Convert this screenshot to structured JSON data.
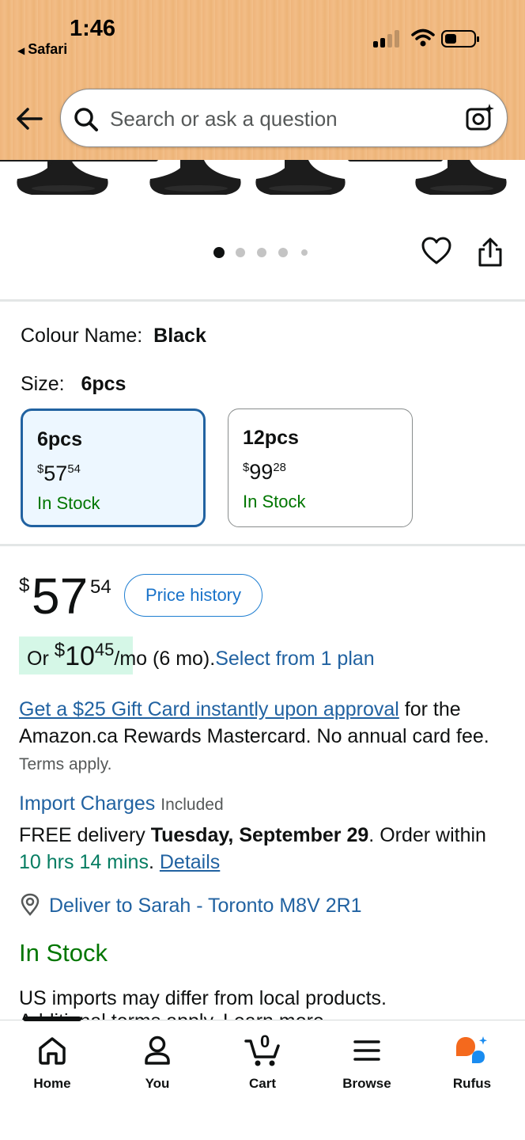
{
  "status_bar": {
    "time": "1:46",
    "back_app": "Safari"
  },
  "search": {
    "placeholder": "Search or ask a question"
  },
  "gallery": {
    "dots_count": 5,
    "active_dot": 0
  },
  "variation": {
    "colour_label": "Colour Name:",
    "colour_value": "Black",
    "size_label": "Size:",
    "size_value": "6pcs",
    "options": [
      {
        "name": "6pcs",
        "currency": "$",
        "whole": "57",
        "fraction": "54",
        "stock": "In Stock",
        "selected": true
      },
      {
        "name": "12pcs",
        "currency": "$",
        "whole": "99",
        "fraction": "28",
        "stock": "In Stock",
        "selected": false
      }
    ]
  },
  "price": {
    "currency": "$",
    "whole": "57",
    "fraction": "54",
    "price_history_label": "Price history"
  },
  "installment": {
    "prefix": "Or",
    "currency": "$",
    "whole": "10",
    "fraction": "45",
    "suffix": "/mo (6 mo).",
    "plan_link": "Select from 1 plan"
  },
  "gift_card": {
    "link": "Get a $25 Gift Card instantly upon approval",
    "text": " for the Amazon.ca Rewards Mastercard. No annual card fee.",
    "terms": "Terms apply."
  },
  "import": {
    "link": "Import Charges",
    "note": "Included"
  },
  "delivery": {
    "free_text": "FREE delivery ",
    "date": "Tuesday, September 29",
    "order_within": ". Order within ",
    "countdown": "10 hrs 14 mins",
    "period": ". ",
    "details_link": "Details"
  },
  "deliver_to": "Deliver to Sarah - Toronto M8V 2R1",
  "stock_status": "In Stock",
  "import_notice": "US imports may differ from local products.",
  "cut_text": "Additional terms apply. Learn more",
  "bottom_nav": {
    "items": [
      {
        "label": "Home",
        "icon": "home-icon"
      },
      {
        "label": "You",
        "icon": "person-icon"
      },
      {
        "label": "Cart",
        "icon": "cart-icon",
        "count": "0"
      },
      {
        "label": "Browse",
        "icon": "menu-icon"
      },
      {
        "label": "Rufus",
        "icon": "rufus-icon"
      }
    ]
  },
  "colors": {
    "header_bg": "#f2bd86",
    "link": "#2162a1",
    "stock_green": "#007600",
    "selected_border": "#2162a1",
    "rufus_orange": "#f4691d",
    "rufus_blue": "#1a8cf0"
  }
}
